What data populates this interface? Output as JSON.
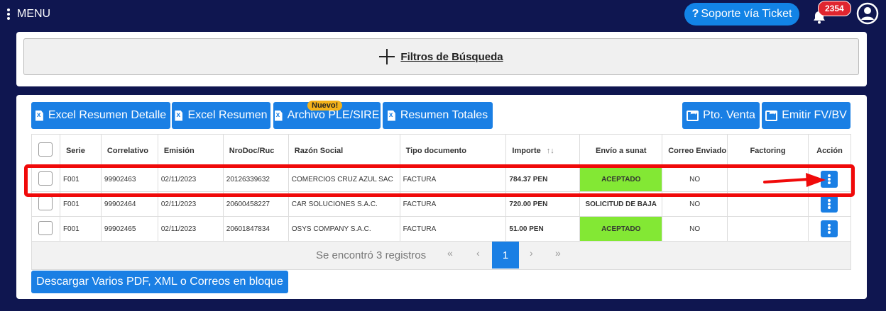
{
  "topbar": {
    "menu_label": "MENU",
    "support_label": "Soporte vía Ticket",
    "notification_count": "2354"
  },
  "filters": {
    "title": "Filtros de Búsqueda"
  },
  "toolbar": {
    "excel_detalle": "Excel Resumen Detalle",
    "excel_resumen": "Excel Resumen",
    "archivo_ple": "Archivo PLE/SIRE",
    "nuevo_badge": "Nuevo!",
    "resumen_totales": "Resumen Totales",
    "pto_venta": "Pto. Venta",
    "emitir": "Emitir FV/BV"
  },
  "table": {
    "headers": [
      "Serie",
      "Correlativo",
      "Emisión",
      "NroDoc/Ruc",
      "Razón Social",
      "Tipo documento",
      "Importe",
      "Envío a sunat",
      "Correo Enviado",
      "Factoring",
      "Acción"
    ],
    "sort_icon": "↑↓",
    "rows": [
      {
        "serie": "F001",
        "correlativo": "99902463",
        "emision": "02/11/2023",
        "nrodoc": "20126339632",
        "razon": "COMERCIOS CRUZ AZUL SAC",
        "tipo": "FACTURA",
        "importe": "784.37 PEN",
        "envio": "ACEPTADO",
        "correo": "NO",
        "factoring": ""
      },
      {
        "serie": "F001",
        "correlativo": "99902464",
        "emision": "02/11/2023",
        "nrodoc": "20600458227",
        "razon": "CAR SOLUCIONES S.A.C.",
        "tipo": "FACTURA",
        "importe": "720.00 PEN",
        "envio": "SOLICITUD DE BAJA",
        "correo": "NO",
        "factoring": ""
      },
      {
        "serie": "F001",
        "correlativo": "99902465",
        "emision": "02/11/2023",
        "nrodoc": "20601847834",
        "razon": "OSYS COMPANY S.A.C.",
        "tipo": "FACTURA",
        "importe": "51.00 PEN",
        "envio": "ACEPTADO",
        "correo": "NO",
        "factoring": ""
      }
    ]
  },
  "pagination": {
    "summary": "Se encontró 3 registros",
    "first": "«",
    "prev": "‹",
    "current": "1",
    "next": "›",
    "last": "»"
  },
  "bulk_button": "Descargar Varios PDF, XML o Correos en bloque",
  "colors": {
    "accent": "#1a7fe4",
    "header_bg": "#0f1650",
    "accepted": "#83e834",
    "annotation": "#f00a0a"
  }
}
